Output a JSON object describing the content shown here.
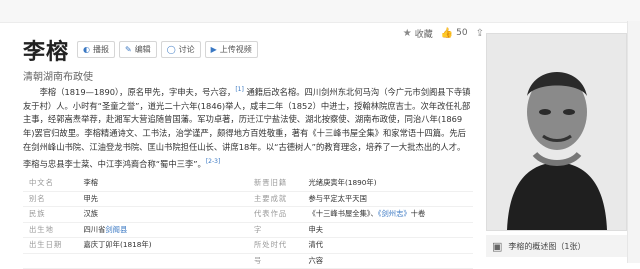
{
  "entry": {
    "title": "李榕",
    "subtitle": "清朝湖南布政使",
    "buttons": [
      {
        "icon": "speaker-icon",
        "label": "播报"
      },
      {
        "icon": "pencil-icon",
        "label": "编辑"
      },
      {
        "icon": "chat-bubble-icon",
        "label": "讨论"
      },
      {
        "icon": "upload-video-icon",
        "label": "上传视频"
      }
    ],
    "actions": {
      "collect_label": "收藏",
      "like_count": "50"
    }
  },
  "intro": {
    "segments": [
      "李榕（1819—1890），原名甲先，字申夫，号六容，",
      "[1]",
      " 通籍后改名榕。四川剑州东北何马沟（今广元市剑阁县下寺镇友于村）人。小时有“圣童之誉”，道光二十六年(1846)举人，咸丰二年（1852）中进士，授翰林院庶吉士。次年改任礼部主事，经郭嵩焘举荐，赴湘军大营追随曾国藩。军功卓著，历迁江宁盐法使、湖北按察使、湖南布政使，同治八年(1869年)罢官归故里。李榕精通诗文、工书法，治学谨严，颇得地方百姓敬重，著有《十三峰书屋全集》和家常语十四篇。先后在剑州峰山书院、江油登龙书院、匡山书院担任山长、讲席18年。以“古德树人”的教育理念，培养了一大批杰出的人才。李榕与忠县李士棻、中江李鸿裔合称“蜀中三李”。",
      "[2-3]"
    ]
  },
  "basic_info": {
    "rows": [
      [
        {
          "k": "中文名",
          "v": "李榕"
        },
        {
          "k": "新晋旧籍",
          "v": "光绪庚寅年(1890年)"
        }
      ],
      [
        {
          "k": "别名",
          "v": "甲先"
        },
        {
          "k": "主要成就",
          "v": "参与平定太平天国"
        }
      ],
      [
        {
          "k": "民族",
          "v": "汉族"
        },
        {
          "k": "代表作品",
          "v": "《十三峰书屋全集》、",
          "link": "《剑州志》",
          "tail": "十卷"
        }
      ],
      [
        {
          "k": "出生地",
          "v": "四川省",
          "link": "剑阁县"
        },
        {
          "k": "字",
          "v": "申夫"
        }
      ],
      [
        {
          "k": "出生日期",
          "v": "嘉庆丁卯年(1818年)"
        },
        {
          "k": "所处时代",
          "v": "清代"
        }
      ],
      [
        {
          "k": "",
          "v": ""
        },
        {
          "k": "号",
          "v": "六容"
        }
      ]
    ]
  },
  "sidebar": {
    "caption": "李榕的概述图（1张）"
  },
  "colors": {
    "accent": "#3a78c3",
    "label_gray": "#999999"
  }
}
